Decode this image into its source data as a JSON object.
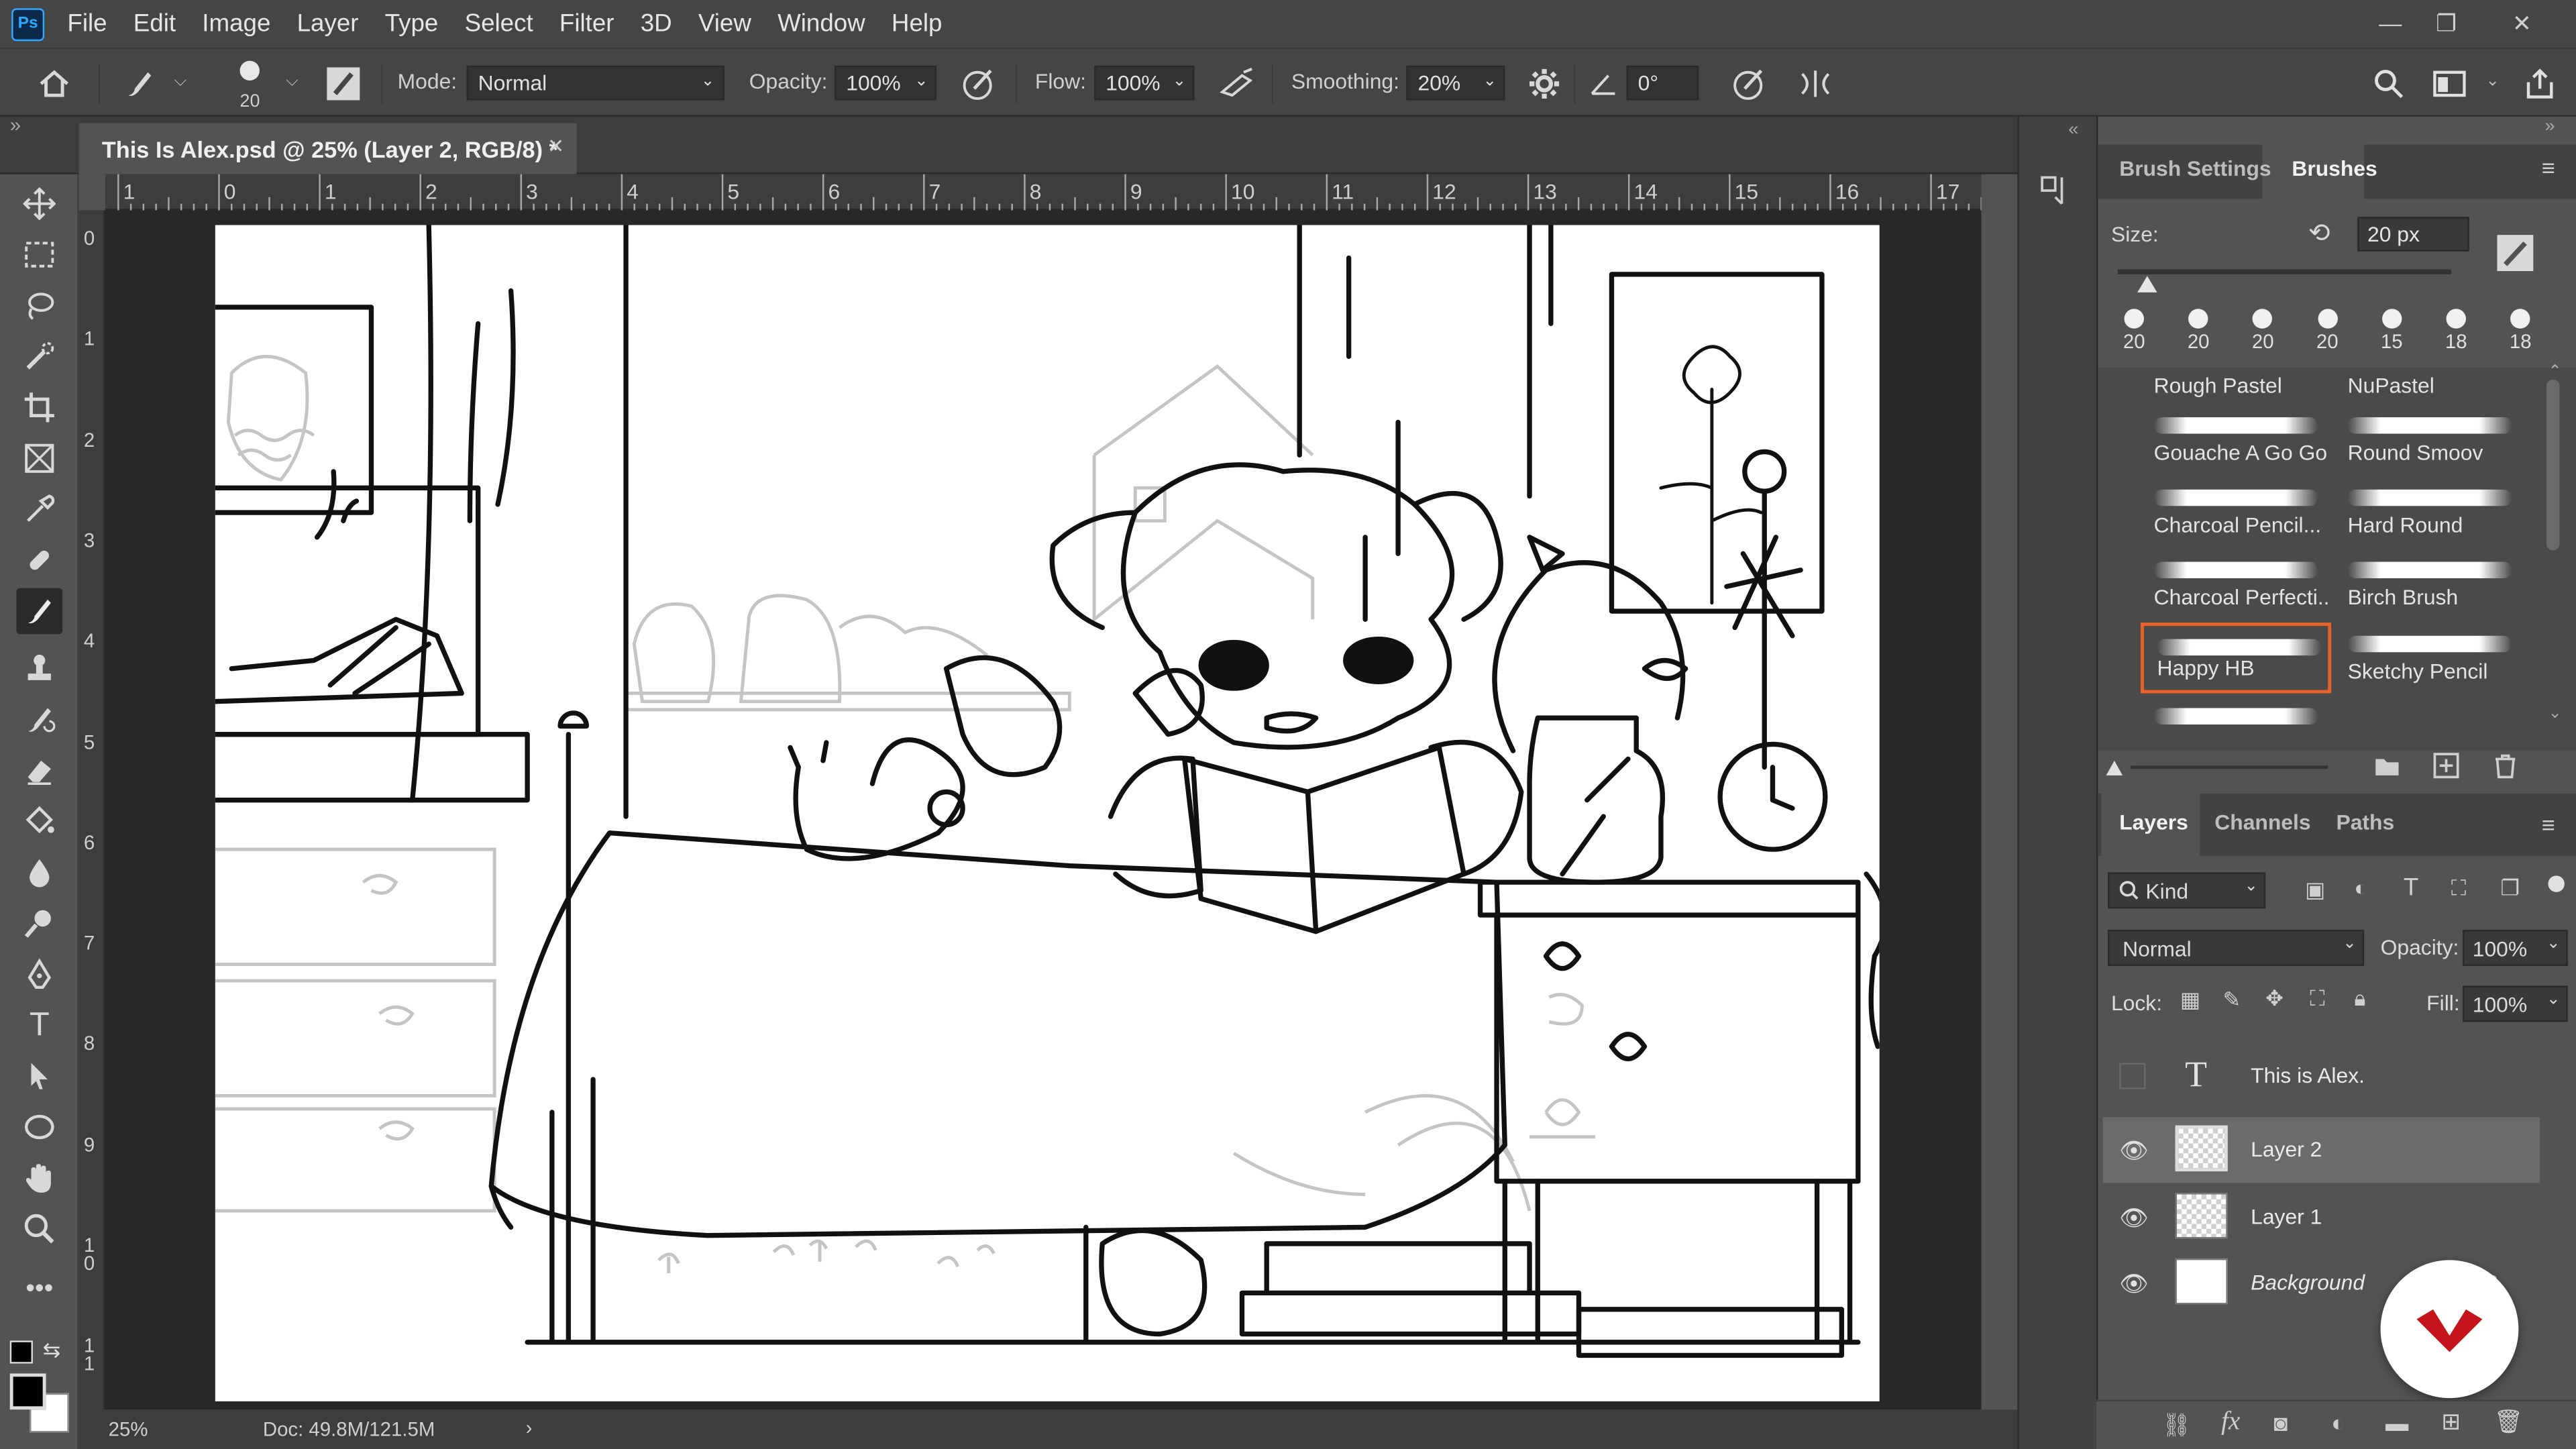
{
  "app": {
    "logo": "Ps"
  },
  "menu": [
    "File",
    "Edit",
    "Image",
    "Layer",
    "Type",
    "Select",
    "Filter",
    "3D",
    "View",
    "Window",
    "Help"
  ],
  "window_controls": {
    "minimize": "—",
    "restore": "❐",
    "close": "✕"
  },
  "options": {
    "brush_size": "20",
    "mode_label": "Mode:",
    "mode_value": "Normal",
    "opacity_label": "Opacity:",
    "opacity_value": "100%",
    "flow_label": "Flow:",
    "flow_value": "100%",
    "smoothing_label": "Smoothing:",
    "smoothing_value": "20%",
    "angle_value": "0°"
  },
  "document": {
    "tab_title": "This Is Alex.psd @ 25% (Layer 2, RGB/8) *",
    "close": "×",
    "zoom": "25%",
    "doc_info": "Doc: 49.8M/121.5M",
    "ruler_h": [
      "1",
      "0",
      "1",
      "2",
      "3",
      "4",
      "5",
      "6",
      "7",
      "8",
      "9",
      "10",
      "11",
      "12",
      "13",
      "14",
      "15",
      "16",
      "17"
    ],
    "ruler_v": [
      "0",
      "1",
      "2",
      "3",
      "4",
      "5",
      "6",
      "7",
      "8",
      "9",
      "1 0",
      "1 1"
    ]
  },
  "brushes_panel": {
    "tabs": [
      "Brush Settings",
      "Brushes"
    ],
    "size_label": "Size:",
    "size_value": "20 px",
    "recent_sizes": [
      "20",
      "20",
      "20",
      "20",
      "15",
      "18",
      "18"
    ],
    "list": [
      {
        "name": "Rough Pastel"
      },
      {
        "name": "NuPastel"
      },
      {
        "name": "Gouache A Go Go"
      },
      {
        "name": "Round Smoov"
      },
      {
        "name": "Charcoal Pencil..."
      },
      {
        "name": "Hard Round"
      },
      {
        "name": "Charcoal Perfecti..."
      },
      {
        "name": "Birch Brush"
      },
      {
        "name": "Happy HB",
        "selected": true
      },
      {
        "name": "Sketchy Pencil"
      }
    ],
    "accent": "#e8622a"
  },
  "layers_panel": {
    "tabs": [
      "Layers",
      "Channels",
      "Paths"
    ],
    "kind_label": "Kind",
    "blend_mode": "Normal",
    "opacity_label": "Opacity:",
    "opacity_value": "100%",
    "lock_label": "Lock:",
    "fill_label": "Fill:",
    "fill_value": "100%",
    "layers": [
      {
        "name": "This is Alex.",
        "type": "text",
        "visible": false
      },
      {
        "name": "Layer 2",
        "type": "pixel",
        "visible": true,
        "selected": true
      },
      {
        "name": "Layer 1",
        "type": "pixel",
        "visible": true
      },
      {
        "name": "Background",
        "type": "background",
        "visible": true
      }
    ],
    "footer_icons": [
      "link-icon",
      "fx-icon",
      "mask-icon",
      "adjustment-icon",
      "folder-icon",
      "new-layer-icon",
      "trash-icon"
    ]
  },
  "colors": {
    "foreground": "#000000",
    "background": "#ffffff",
    "watermark": "#c4151c"
  }
}
